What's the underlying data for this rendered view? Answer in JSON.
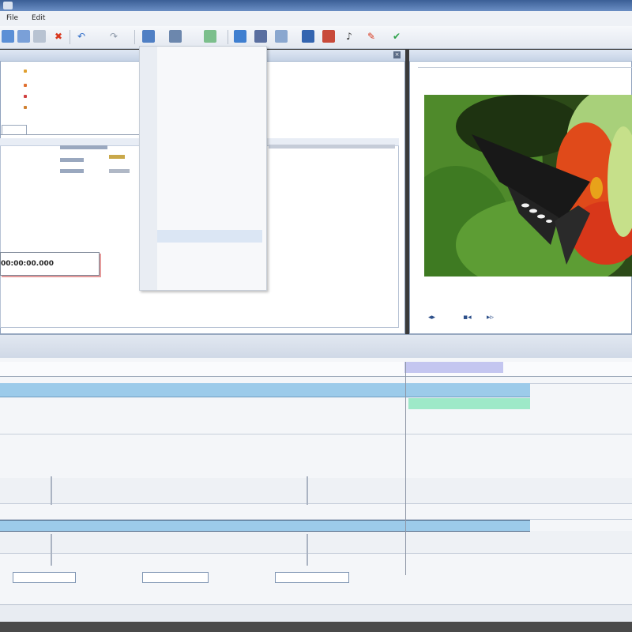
{
  "window": {
    "title": ""
  },
  "menubar": {
    "items": [
      "File",
      "Edit"
    ]
  },
  "toolbar": {
    "buttons": [
      {
        "icon": "new-project-icon"
      },
      {
        "icon": "open-icon"
      },
      {
        "icon": "save-icon"
      },
      {
        "icon": "delete-icon",
        "color": "#d9381e"
      },
      {
        "icon": "undo-icon",
        "color": "#2e6bc8"
      },
      {
        "icon": "redo-icon"
      },
      {
        "icon": "add-media-icon"
      },
      {
        "icon": "add-text-icon"
      },
      {
        "icon": "add-effect-icon"
      },
      {
        "icon": "export-icon"
      },
      {
        "icon": "film-icon"
      },
      {
        "icon": "settings-icon"
      },
      {
        "icon": "music-icon"
      },
      {
        "icon": "color-icon"
      },
      {
        "icon": "help-icon"
      },
      {
        "icon": "tools-icon"
      },
      {
        "icon": "ok-icon",
        "color": "#2ea24a"
      }
    ]
  },
  "properties": {
    "time_display": "00:00:00.000",
    "rows": [
      "",
      "",
      "",
      ""
    ]
  },
  "dropdown": {
    "items": [
      "",
      "",
      "",
      "",
      "",
      "",
      "",
      "",
      "",
      "",
      "",
      "",
      "",
      "",
      "",
      "",
      ""
    ],
    "highlighted_index": 13
  },
  "preview": {
    "panel_title": ""
  },
  "timeline": {
    "ruler_labels": [
      "",
      "",
      "",
      "",
      "",
      "",
      "",
      "",
      "",
      ""
    ],
    "clip_label": ""
  },
  "status": {
    "text": ""
  },
  "colors": {
    "accent": "#3b5f96",
    "clip_video": "#9ccbea",
    "clip_text": "#9ee9c8",
    "selection": "#c4c6f0"
  }
}
